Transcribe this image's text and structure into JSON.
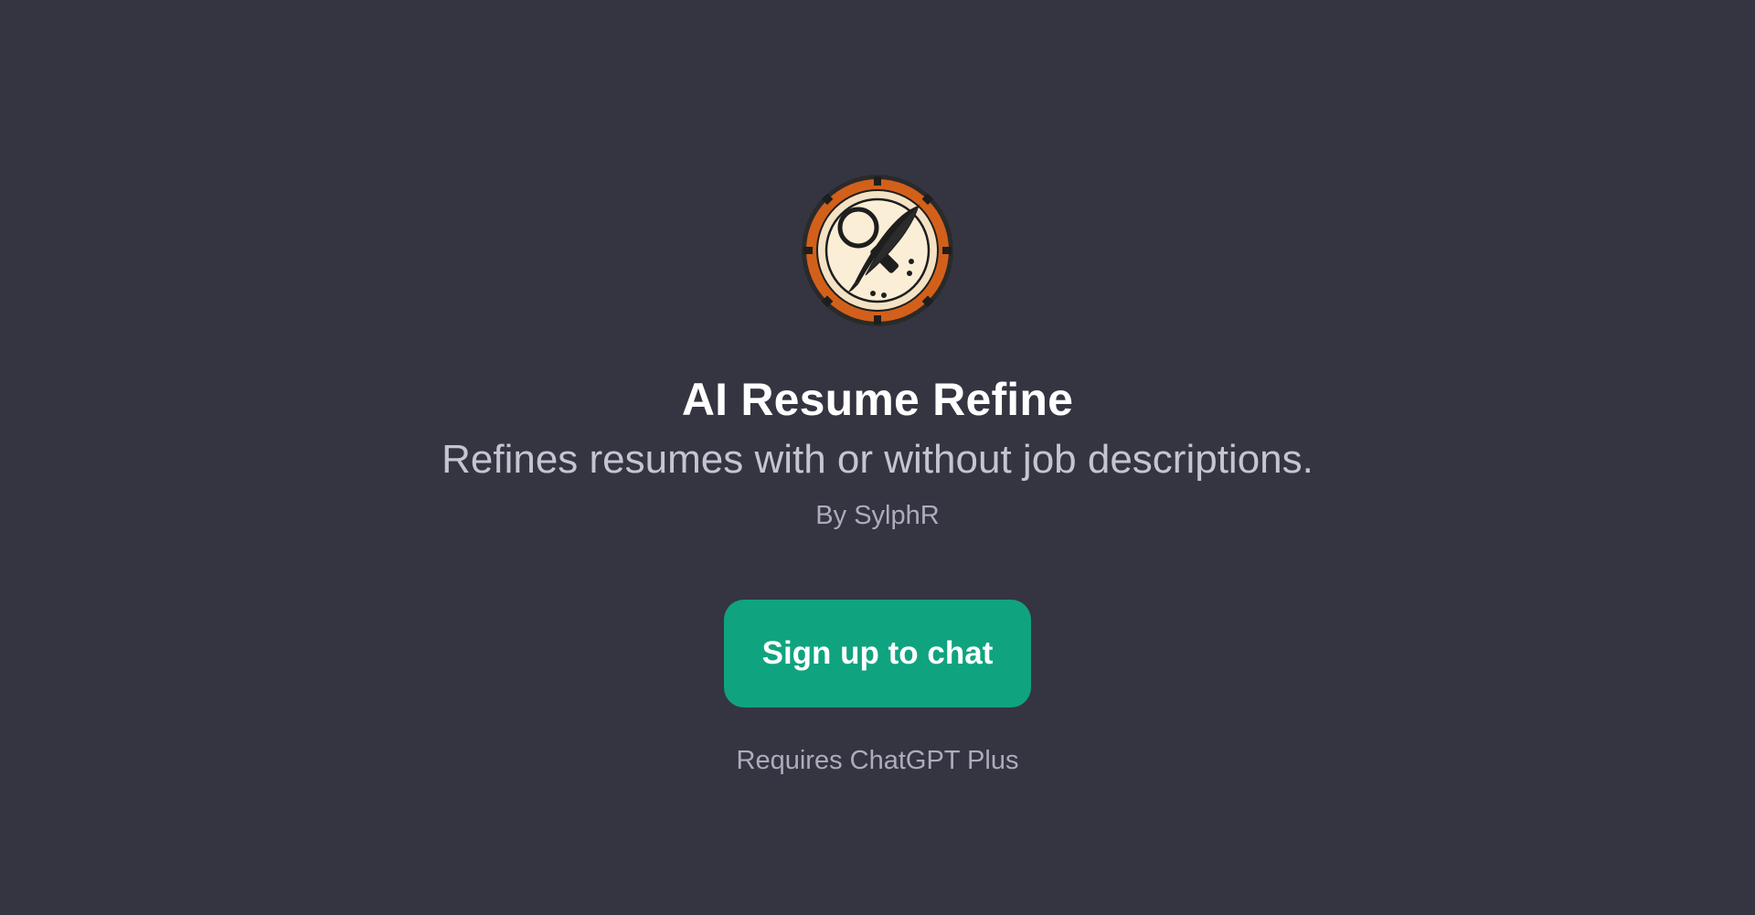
{
  "gpt": {
    "name": "AI Resume Refine",
    "description": "Refines resumes with or without job descriptions.",
    "author_line": "By SylphR",
    "avatar_icon": "resume-refine-logo-icon"
  },
  "actions": {
    "signup_label": "Sign up to chat",
    "requirement_note": "Requires ChatGPT Plus"
  },
  "colors": {
    "background": "#343541",
    "accent": "#10a37f",
    "title": "#ffffff",
    "subtitle": "#c5c5d2",
    "muted": "#acacbe"
  }
}
